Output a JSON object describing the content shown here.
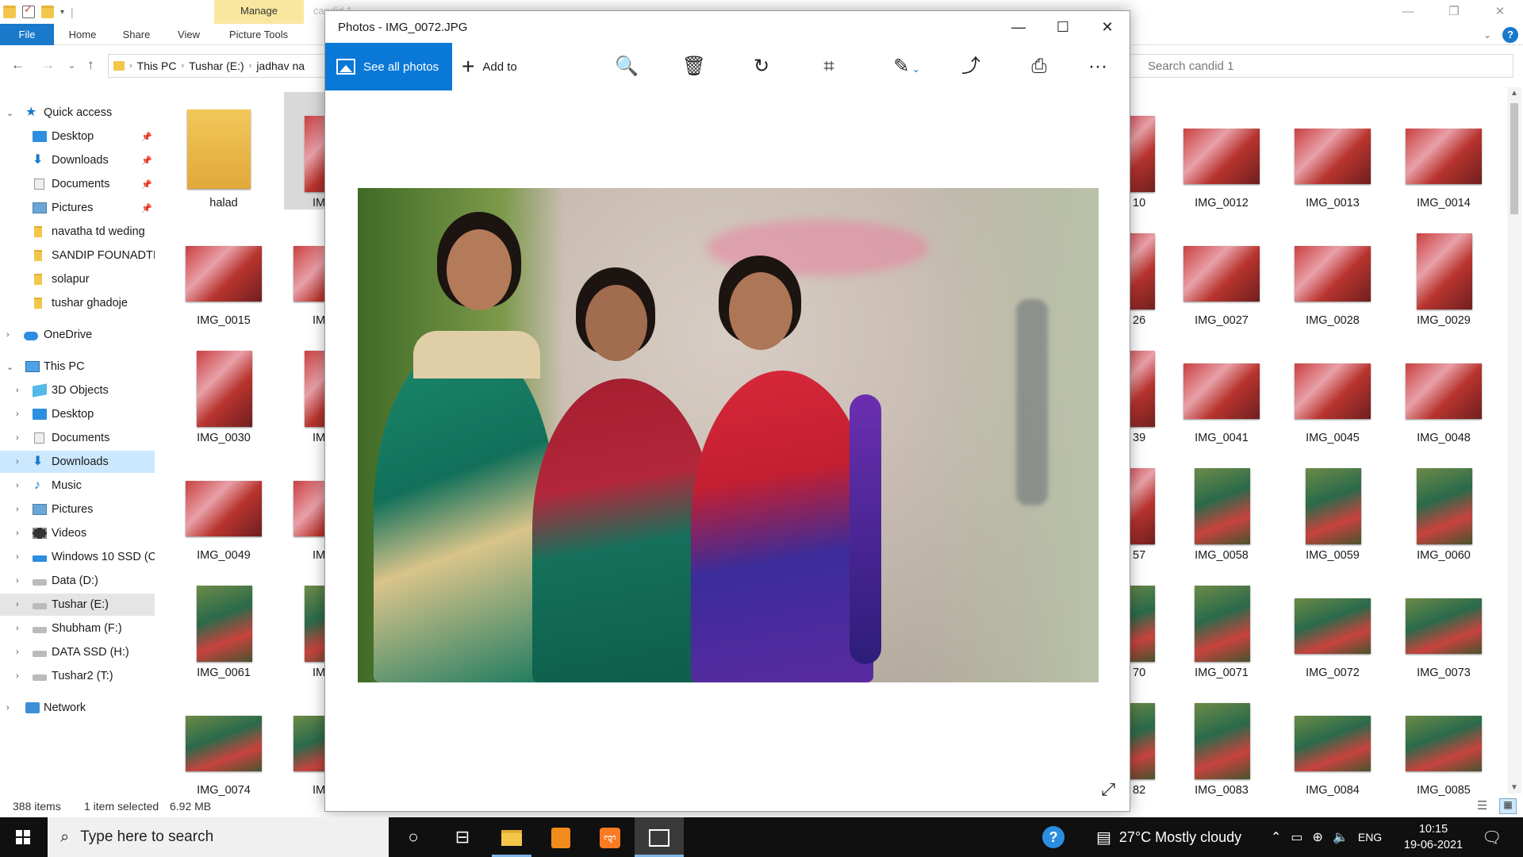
{
  "explorer": {
    "context_tab": "Manage",
    "ghost_title": "candid 1",
    "ribbon_tabs": {
      "file": "File",
      "home": "Home",
      "share": "Share",
      "view": "View",
      "picture_tools": "Picture Tools"
    },
    "path": [
      "This PC",
      "Tushar (E:)",
      "jadhav na"
    ],
    "search_placeholder": "Search candid 1",
    "nav": {
      "quick_access": "Quick access",
      "qa_items": [
        "Desktop",
        "Downloads",
        "Documents",
        "Pictures",
        "navatha td weding",
        "SANDIP FOUNADTI(",
        "solapur",
        "tushar ghadoje"
      ],
      "onedrive": "OneDrive",
      "this_pc": "This PC",
      "pc_items": [
        "3D Objects",
        "Desktop",
        "Documents",
        "Downloads",
        "Music",
        "Pictures",
        "Videos",
        "Windows 10 SSD (C",
        "Data (D:)",
        "Tushar (E:)",
        "Shubham (F:)",
        "DATA SSD (H:)",
        "Tushar2 (T:)"
      ],
      "network": "Network"
    },
    "col_left": [
      "halad",
      "IMG_0015",
      "IMG_0030",
      "IMG_0049",
      "IMG_0061",
      "IMG_0074"
    ],
    "col_partial": [
      "IMG",
      "IMG",
      "IMG",
      "IMG",
      "IMG",
      "IMG"
    ],
    "col_right_partial": [
      "10",
      "26",
      "39",
      "57",
      "70",
      "82"
    ],
    "cols_right": [
      [
        "IMG_0012",
        "IMG_0027",
        "IMG_0041",
        "IMG_0058",
        "IMG_0071",
        "IMG_0083"
      ],
      [
        "IMG_0013",
        "IMG_0028",
        "IMG_0045",
        "IMG_0059",
        "IMG_0072",
        "IMG_0084"
      ],
      [
        "IMG_0014",
        "IMG_0029",
        "IMG_0048",
        "IMG_0060",
        "IMG_0073",
        "IMG_0085"
      ]
    ],
    "status": {
      "items": "388 items",
      "selected": "1 item selected",
      "size": "6.92 MB"
    }
  },
  "photos": {
    "title": "Photos - IMG_0072.JPG",
    "see_all": "See all photos",
    "add_to": "Add to"
  },
  "taskbar": {
    "search_placeholder": "Type here to search",
    "weather": "27°C  Mostly cloudy",
    "lang": "ENG",
    "time": "10:15",
    "date": "19-06-2021"
  }
}
